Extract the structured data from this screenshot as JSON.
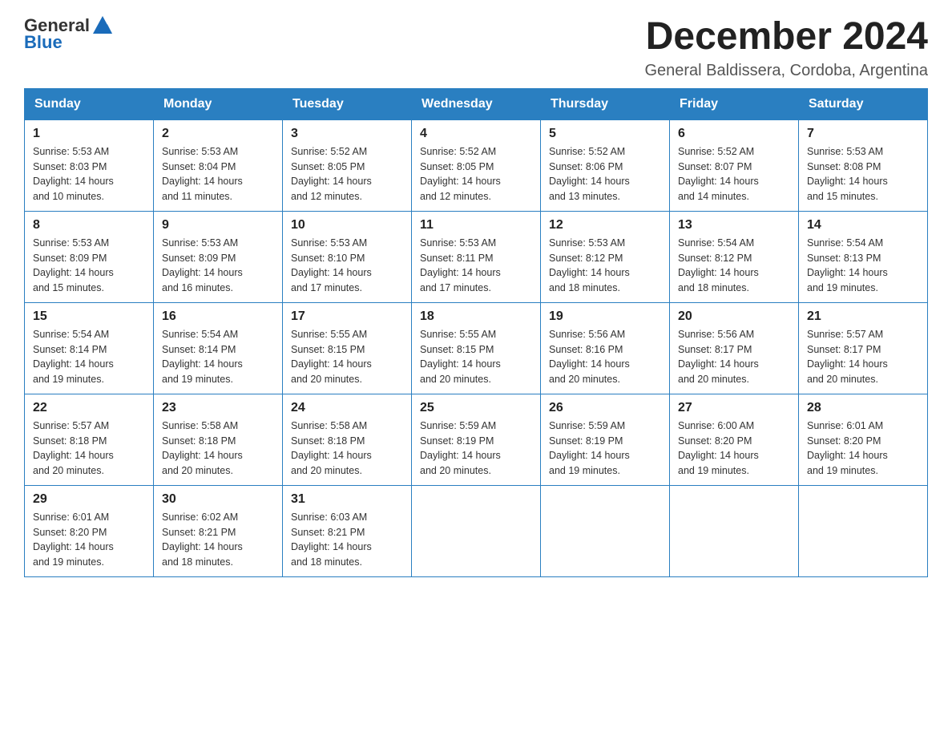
{
  "header": {
    "logo_text_general": "General",
    "logo_text_blue": "Blue",
    "month_title": "December 2024",
    "subtitle": "General Baldissera, Cordoba, Argentina"
  },
  "weekdays": [
    "Sunday",
    "Monday",
    "Tuesday",
    "Wednesday",
    "Thursday",
    "Friday",
    "Saturday"
  ],
  "weeks": [
    [
      {
        "day": "1",
        "sunrise": "5:53 AM",
        "sunset": "8:03 PM",
        "daylight": "14 hours and 10 minutes."
      },
      {
        "day": "2",
        "sunrise": "5:53 AM",
        "sunset": "8:04 PM",
        "daylight": "14 hours and 11 minutes."
      },
      {
        "day": "3",
        "sunrise": "5:52 AM",
        "sunset": "8:05 PM",
        "daylight": "14 hours and 12 minutes."
      },
      {
        "day": "4",
        "sunrise": "5:52 AM",
        "sunset": "8:05 PM",
        "daylight": "14 hours and 12 minutes."
      },
      {
        "day": "5",
        "sunrise": "5:52 AM",
        "sunset": "8:06 PM",
        "daylight": "14 hours and 13 minutes."
      },
      {
        "day": "6",
        "sunrise": "5:52 AM",
        "sunset": "8:07 PM",
        "daylight": "14 hours and 14 minutes."
      },
      {
        "day": "7",
        "sunrise": "5:53 AM",
        "sunset": "8:08 PM",
        "daylight": "14 hours and 15 minutes."
      }
    ],
    [
      {
        "day": "8",
        "sunrise": "5:53 AM",
        "sunset": "8:09 PM",
        "daylight": "14 hours and 15 minutes."
      },
      {
        "day": "9",
        "sunrise": "5:53 AM",
        "sunset": "8:09 PM",
        "daylight": "14 hours and 16 minutes."
      },
      {
        "day": "10",
        "sunrise": "5:53 AM",
        "sunset": "8:10 PM",
        "daylight": "14 hours and 17 minutes."
      },
      {
        "day": "11",
        "sunrise": "5:53 AM",
        "sunset": "8:11 PM",
        "daylight": "14 hours and 17 minutes."
      },
      {
        "day": "12",
        "sunrise": "5:53 AM",
        "sunset": "8:12 PM",
        "daylight": "14 hours and 18 minutes."
      },
      {
        "day": "13",
        "sunrise": "5:54 AM",
        "sunset": "8:12 PM",
        "daylight": "14 hours and 18 minutes."
      },
      {
        "day": "14",
        "sunrise": "5:54 AM",
        "sunset": "8:13 PM",
        "daylight": "14 hours and 19 minutes."
      }
    ],
    [
      {
        "day": "15",
        "sunrise": "5:54 AM",
        "sunset": "8:14 PM",
        "daylight": "14 hours and 19 minutes."
      },
      {
        "day": "16",
        "sunrise": "5:54 AM",
        "sunset": "8:14 PM",
        "daylight": "14 hours and 19 minutes."
      },
      {
        "day": "17",
        "sunrise": "5:55 AM",
        "sunset": "8:15 PM",
        "daylight": "14 hours and 20 minutes."
      },
      {
        "day": "18",
        "sunrise": "5:55 AM",
        "sunset": "8:15 PM",
        "daylight": "14 hours and 20 minutes."
      },
      {
        "day": "19",
        "sunrise": "5:56 AM",
        "sunset": "8:16 PM",
        "daylight": "14 hours and 20 minutes."
      },
      {
        "day": "20",
        "sunrise": "5:56 AM",
        "sunset": "8:17 PM",
        "daylight": "14 hours and 20 minutes."
      },
      {
        "day": "21",
        "sunrise": "5:57 AM",
        "sunset": "8:17 PM",
        "daylight": "14 hours and 20 minutes."
      }
    ],
    [
      {
        "day": "22",
        "sunrise": "5:57 AM",
        "sunset": "8:18 PM",
        "daylight": "14 hours and 20 minutes."
      },
      {
        "day": "23",
        "sunrise": "5:58 AM",
        "sunset": "8:18 PM",
        "daylight": "14 hours and 20 minutes."
      },
      {
        "day": "24",
        "sunrise": "5:58 AM",
        "sunset": "8:18 PM",
        "daylight": "14 hours and 20 minutes."
      },
      {
        "day": "25",
        "sunrise": "5:59 AM",
        "sunset": "8:19 PM",
        "daylight": "14 hours and 20 minutes."
      },
      {
        "day": "26",
        "sunrise": "5:59 AM",
        "sunset": "8:19 PM",
        "daylight": "14 hours and 19 minutes."
      },
      {
        "day": "27",
        "sunrise": "6:00 AM",
        "sunset": "8:20 PM",
        "daylight": "14 hours and 19 minutes."
      },
      {
        "day": "28",
        "sunrise": "6:01 AM",
        "sunset": "8:20 PM",
        "daylight": "14 hours and 19 minutes."
      }
    ],
    [
      {
        "day": "29",
        "sunrise": "6:01 AM",
        "sunset": "8:20 PM",
        "daylight": "14 hours and 19 minutes."
      },
      {
        "day": "30",
        "sunrise": "6:02 AM",
        "sunset": "8:21 PM",
        "daylight": "14 hours and 18 minutes."
      },
      {
        "day": "31",
        "sunrise": "6:03 AM",
        "sunset": "8:21 PM",
        "daylight": "14 hours and 18 minutes."
      },
      null,
      null,
      null,
      null
    ]
  ],
  "labels": {
    "sunrise": "Sunrise:",
    "sunset": "Sunset:",
    "daylight": "Daylight:"
  }
}
